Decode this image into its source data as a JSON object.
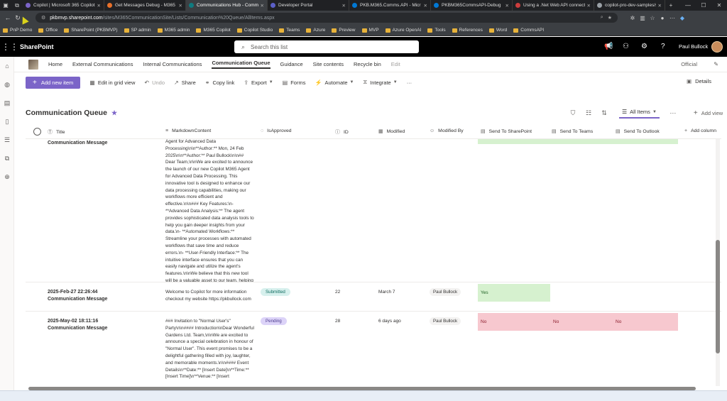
{
  "browser": {
    "tabs": [
      {
        "label": "Copilot | Microsoft 365 Copilot",
        "color": "#7b64c8"
      },
      {
        "label": "Get Messages Debug - M365",
        "color": "#e8702a"
      },
      {
        "label": "Communications Hub - Comm",
        "color": "#0f7b80",
        "active": true
      },
      {
        "label": "Developer Portal",
        "color": "#5b5fc7"
      },
      {
        "label": "PKB.M365.Comms.API - Micr",
        "color": "#0078d4"
      },
      {
        "label": "PKBM365CommsAPI-Debug",
        "color": "#0078d4"
      },
      {
        "label": "Using a .Net Web API connect",
        "color": "#cc3d3d"
      },
      {
        "label": "copilot-pro-dev-samples/sam",
        "color": "#9aa0a6"
      }
    ],
    "url_host": "pkbmvp.sharepoint.com",
    "url_path": "/sites/M365CommunicationSite/Lists/Communication%20Queue/AllItems.aspx",
    "favorites": [
      "PnP Demo",
      "Office",
      "SharePoint (PKBMVP)",
      "SP admin",
      "M365 admin",
      "M365 Copilot",
      "Copilot Studio",
      "Teams",
      "Azure",
      "Preview",
      "MVP",
      "Azure OpenAI",
      "Tools",
      "References",
      "Word",
      "CommsAPI"
    ]
  },
  "header": {
    "brand": "SharePoint",
    "search_placeholder": "Search this list",
    "user_name": "Paul Bullock"
  },
  "sitenav": {
    "links": [
      "Home",
      "External Communications",
      "Internal Communications",
      "Communication Queue",
      "Guidance",
      "Site contents",
      "Recycle bin",
      "Edit"
    ],
    "selected": "Communication Queue",
    "official": "Official"
  },
  "commands": {
    "new_item": "Add new item",
    "edit_grid": "Edit in grid view",
    "undo": "Undo",
    "share": "Share",
    "copy_link": "Copy link",
    "export": "Export",
    "forms": "Forms",
    "automate": "Automate",
    "integrate": "Integrate",
    "more": "···",
    "details": "Details"
  },
  "view": {
    "title": "Communication Queue",
    "current_view": "All Items",
    "add_view": "Add view"
  },
  "columns": {
    "title": "Title",
    "markdown": "MarkdownContent",
    "approved": "IsApproved",
    "id": "ID",
    "modified": "Modified",
    "modified_by": "Modified By",
    "send_sp": "Send To SharePoint",
    "send_teams": "Send To Teams",
    "send_outlook": "Send To Outlook",
    "add_column": "Add column"
  },
  "rows": [
    {
      "title_line1": "",
      "title_line2": "Communication Message",
      "markdown": "Agent for Advanced Data Processing\\n\\n**Author:** Mon, 24 Feb 2025\\n\\n**Author:** Paul Bullock\\n\\n## Dear Team,\\n\\nWe are excited to announce the launch of our new Copilot M365 Agent for Advanced Data Processing. This innovative tool is designed to enhance our data processing capabilities, making our workflows more efficient and effective.\\n\\n### Key Features:\\n- **Advanced Data Analysis:** The agent provides sophisticated data analysis tools to help you gain deeper insights from your data.\\n- **Automated Workflows:** Streamline your processes with automated workflows that save time and reduce errors.\\n- **User-Friendly Interface:** The intuitive interface ensures that you can easily navigate and utilize the agent's features.\\n\\nWe believe that this new tool will be a valuable asset to our team, helping us to achieve our goals more effectively. We encourage you to ..."
    },
    {
      "title_line1": "2025-Feb-27 22:26:44",
      "title_line2": "Communication Message",
      "markdown": "Welcome to Copilot for more information checkout my website https://pkbullock.com",
      "approved": "Submitted",
      "id": "22",
      "modified": "March 7",
      "modified_by": "Paul Bullock",
      "send_sp": "Yes"
    },
    {
      "title_line1": "2025-May-02 18:11:16",
      "title_line2": "Communication Message",
      "markdown": "### Invitation to \"Normal User's\" Party\\n\\n#### Introduction\\nDear Wonderful Gardens Ltd. Team,\\n\\nWe are excited to announce a special celebration in honour of \"Normal User\". This event promises to be a delightful gathering filled with joy, laughter, and memorable moments.\\n\\n#### Event Details\\n**Date:** [Insert Date]\\n**Time:** [Insert Time]\\n**Venue:** [Insert",
      "approved": "Pending",
      "id": "28",
      "modified": "6 days ago",
      "modified_by": "Paul Bullock",
      "send_sp": "No",
      "send_teams": "No",
      "send_outlook": "No"
    }
  ],
  "colors": {
    "accent": "#7b64c8",
    "yes_green": "#d6f1cf",
    "no_red": "#f7c8cf"
  }
}
